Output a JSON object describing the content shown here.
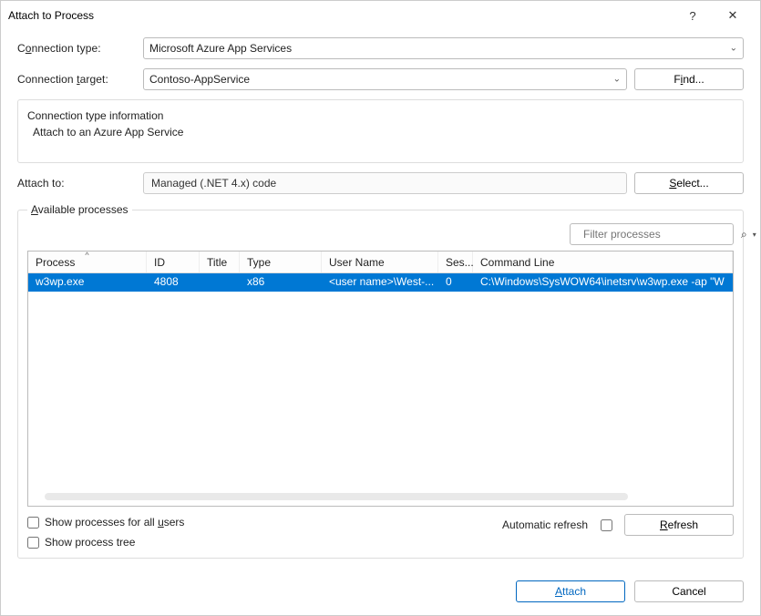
{
  "title": "Attach to Process",
  "titlebar": {
    "help_label": "?",
    "close_label": "✕"
  },
  "connection": {
    "type_label_pre": "C",
    "type_label_u": "o",
    "type_label_post": "nnection type:",
    "type_value": "Microsoft Azure App Services",
    "target_label_pre": "Connection ",
    "target_label_u": "t",
    "target_label_post": "arget:",
    "target_value": "Contoso-AppService",
    "find_pre": "F",
    "find_u": "i",
    "find_post": "nd..."
  },
  "info": {
    "heading": "Connection type information",
    "line1": "Attach to an Azure App Service"
  },
  "attach": {
    "label": "Attach to:",
    "value": "Managed (.NET 4.x) code",
    "select_pre": "",
    "select_u": "S",
    "select_post": "elect..."
  },
  "available": {
    "legend_u": "A",
    "legend_post": "vailable processes",
    "filter_placeholder": "Filter processes"
  },
  "columns": {
    "process": "Process",
    "id": "ID",
    "title": "Title",
    "type": "Type",
    "user": "User Name",
    "ses": "Ses...",
    "cmd": "Command Line"
  },
  "rows": [
    {
      "process": "w3wp.exe",
      "id": "4808",
      "title": "",
      "type": "x86",
      "user": "<user name>\\West-...",
      "ses": "0",
      "cmd": "C:\\Windows\\SysWOW64\\inetsrv\\w3wp.exe -ap \"W"
    }
  ],
  "footer": {
    "show_all_pre": "Show processes for all ",
    "show_all_u": "u",
    "show_all_post": "sers",
    "show_tree": "Show process tree",
    "auto_refresh": "Automatic refresh",
    "refresh_u": "R",
    "refresh_post": "efresh",
    "attach_u": "A",
    "attach_post": "ttach",
    "cancel": "Cancel"
  }
}
